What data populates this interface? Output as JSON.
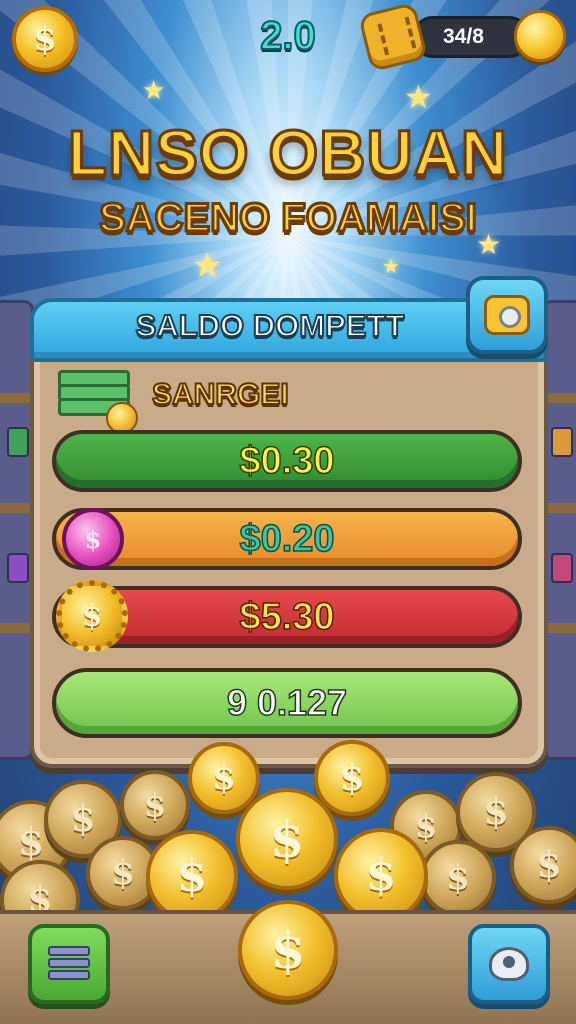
{
  "hud": {
    "level": "2.0",
    "ticket_counter": "34/8",
    "coin_symbol": "$"
  },
  "title": {
    "line1": "LNSO OBUAN",
    "line2": "SACENO FOAMAISI"
  },
  "wallet": {
    "header": "SALDO DOMPETT",
    "bonus_label": "SANRGEI",
    "balances": [
      {
        "label": "$0.30",
        "color": "#3a9b3a"
      },
      {
        "label": "$0.20",
        "color": "#ef9e3a"
      },
      {
        "label": "$5.30",
        "color": "#d23a40"
      },
      {
        "label": "9 0.127",
        "color": "#8fd86a"
      }
    ]
  },
  "coin_symbol": "$",
  "colors": {
    "accent_blue": "#2ea4dc",
    "panel_tan": "#c9ab89",
    "coin_gold": "#f3c02d"
  },
  "icons": {
    "top_left": "dollar-coin-icon",
    "ticket": "ticket-icon",
    "settings": "settings-gear-icon",
    "cash": "cash-stack-icon",
    "pink_gem": "pink-dollar-gem-icon",
    "gear_coin": "gear-dollar-coin-icon",
    "book": "spell-book-icon",
    "nav": "blob-character-icon"
  }
}
